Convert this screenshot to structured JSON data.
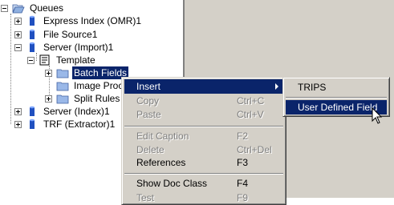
{
  "tree": {
    "root": "Queues",
    "items": [
      {
        "label": "Express Index (OMR)1"
      },
      {
        "label": "File Source1"
      },
      {
        "label": "Server (Import)1"
      },
      {
        "label": "Template"
      },
      {
        "label": "Batch Fields"
      },
      {
        "label": "Image Proce"
      },
      {
        "label": "Split Rules"
      },
      {
        "label": "Server (Index)1"
      },
      {
        "label": "TRF (Extractor)1"
      }
    ]
  },
  "context_menu": {
    "items": [
      {
        "label": "Insert",
        "shortcut": "",
        "enabled": true
      },
      {
        "label": "Copy",
        "shortcut": "Ctrl+C",
        "enabled": false
      },
      {
        "label": "Paste",
        "shortcut": "Ctrl+V",
        "enabled": false
      },
      {
        "label": "Edit Caption",
        "shortcut": "F2",
        "enabled": false
      },
      {
        "label": "Delete",
        "shortcut": "Ctrl+Del",
        "enabled": false
      },
      {
        "label": "References",
        "shortcut": "F3",
        "enabled": true
      },
      {
        "label": "Show Doc Class",
        "shortcut": "F4",
        "enabled": true
      },
      {
        "label": "Test",
        "shortcut": "F9",
        "enabled": false
      }
    ]
  },
  "submenu": {
    "items": [
      {
        "label": "TRIPS"
      },
      {
        "label": "User Defined Field"
      }
    ]
  },
  "colors": {
    "selection": "#0a246a",
    "menu_bg": "#d4d0c8",
    "disabled_text": "#808080"
  }
}
